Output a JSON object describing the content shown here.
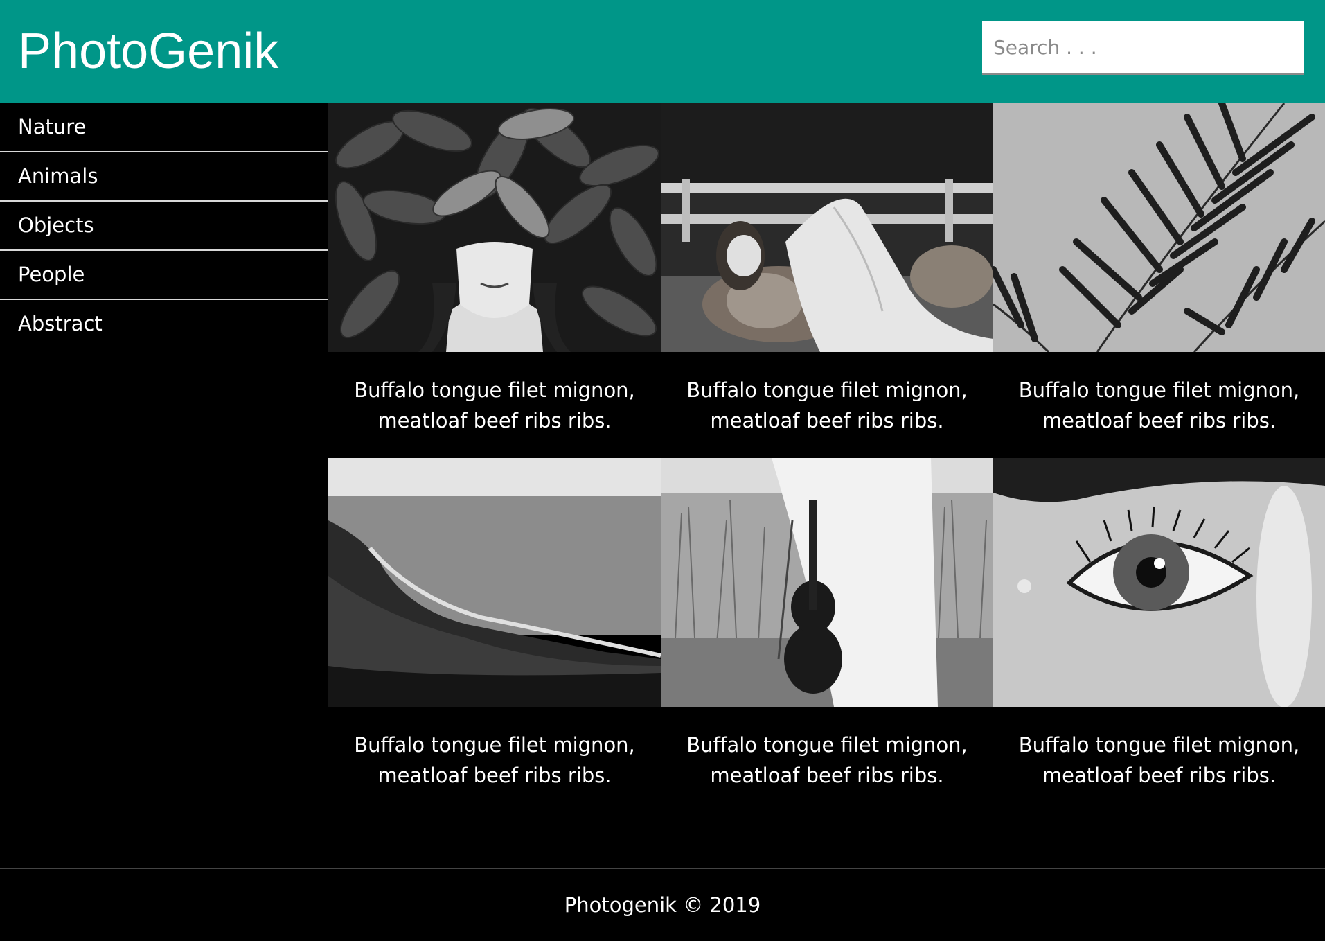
{
  "header": {
    "brand": "PhotoGenik",
    "search_placeholder": "Search . . .",
    "bg_color": "#009688"
  },
  "sidebar": {
    "items": [
      {
        "label": "Nature"
      },
      {
        "label": "Animals"
      },
      {
        "label": "Objects"
      },
      {
        "label": "People"
      },
      {
        "label": "Abstract"
      }
    ]
  },
  "gallery": {
    "cards": [
      {
        "image": "woman-in-leaves",
        "caption_line1": "Buffalo tongue filet mignon,",
        "caption_line2": "meatloaf beef ribs ribs."
      },
      {
        "image": "girl-with-dog",
        "caption_line1": "Buffalo tongue filet mignon,",
        "caption_line2": "meatloaf beef ribs ribs."
      },
      {
        "image": "palm-fronds",
        "caption_line1": "Buffalo tongue filet mignon,",
        "caption_line2": "meatloaf beef ribs ribs."
      },
      {
        "image": "coastline",
        "caption_line1": "Buffalo tongue filet mignon,",
        "caption_line2": "meatloaf beef ribs ribs."
      },
      {
        "image": "violin-in-grass",
        "caption_line1": "Buffalo tongue filet mignon,",
        "caption_line2": "meatloaf beef ribs ribs."
      },
      {
        "image": "eye-closeup",
        "caption_line1": "Buffalo tongue filet mignon,",
        "caption_line2": "meatloaf beef ribs ribs."
      }
    ]
  },
  "footer": {
    "text": "Photogenik © 2019"
  }
}
